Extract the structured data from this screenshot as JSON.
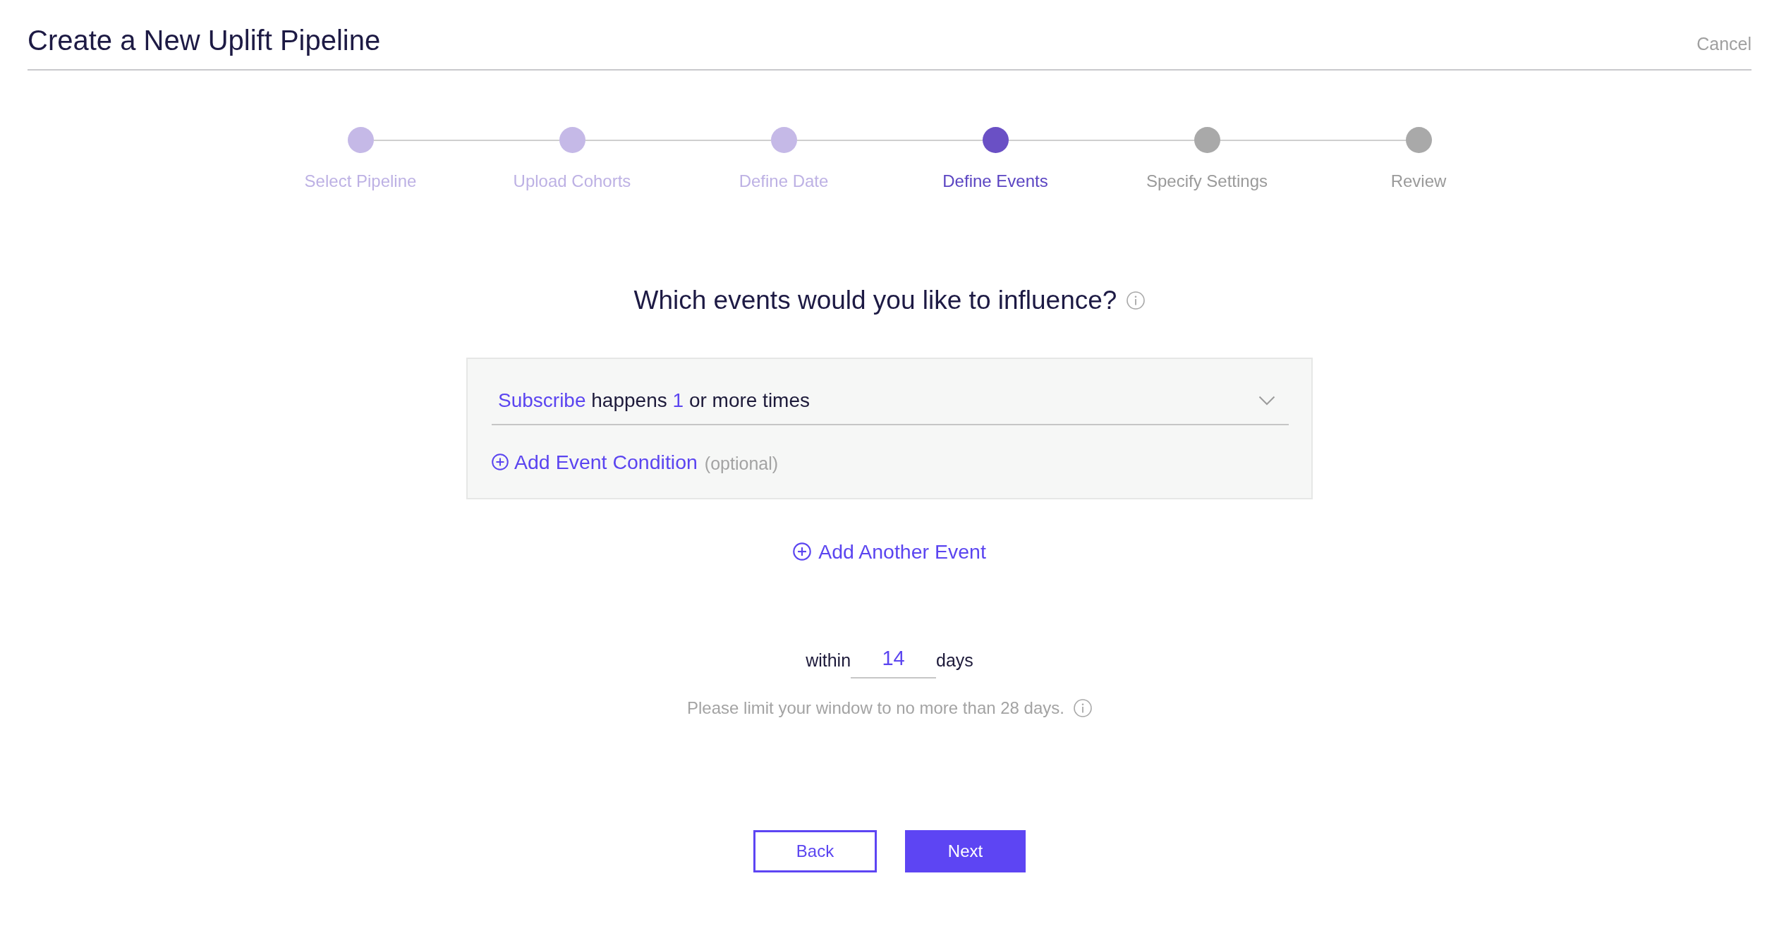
{
  "header": {
    "title": "Create a New Uplift Pipeline",
    "cancel_link": "Cancel"
  },
  "stepper": {
    "steps": [
      {
        "label": "Select Pipeline",
        "completed": true,
        "selected": false
      },
      {
        "label": "Upload Cohorts",
        "completed": true,
        "selected": false
      },
      {
        "label": "Define Date",
        "completed": true,
        "selected": false
      },
      {
        "label": "Define Events",
        "completed": false,
        "selected": true
      },
      {
        "label": "Specify Settings",
        "completed": false,
        "selected": false
      },
      {
        "label": "Review",
        "completed": false,
        "selected": false
      }
    ]
  },
  "question": {
    "text": "Which events would you like to influence?"
  },
  "events": [
    {
      "event": "Subscribe",
      "verb": "happens",
      "count": "1",
      "suffix": "or more times",
      "add_condition": {
        "label": "Add Event Condition",
        "note": "(optional)"
      }
    }
  ],
  "add_event": {
    "label": "Add Another Event"
  },
  "window": {
    "prefix": "within",
    "value": "14",
    "unit": "days",
    "hint": "Please limit your window to no more than 28 days."
  },
  "buttons": [
    {
      "label": "Back",
      "kind": "secondary"
    },
    {
      "label": "Next",
      "kind": "primary"
    }
  ]
}
